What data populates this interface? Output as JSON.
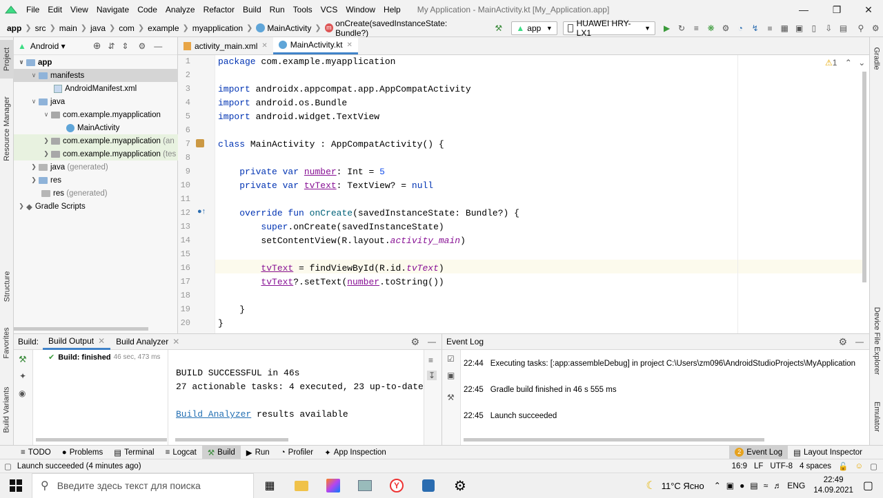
{
  "menu": {
    "items": [
      "File",
      "Edit",
      "View",
      "Navigate",
      "Code",
      "Analyze",
      "Refactor",
      "Build",
      "Run",
      "Tools",
      "VCS",
      "Window",
      "Help"
    ],
    "window_title": "My Application - MainActivity.kt [My_Application.app]"
  },
  "breadcrumb": [
    "app",
    "src",
    "main",
    "java",
    "com",
    "example",
    "myapplication",
    "MainActivity",
    "onCreate(savedInstanceState: Bundle?)"
  ],
  "toolbar": {
    "run_config": "app",
    "device": "HUAWEI HRY-LX1"
  },
  "side_tabs": {
    "left": [
      "Project",
      "Resource Manager",
      "Structure",
      "Favorites",
      "Build Variants"
    ],
    "right": [
      "Gradle",
      "Device File Explorer",
      "Emulator"
    ]
  },
  "project": {
    "view_mode": "Android",
    "tree": [
      {
        "label": "app",
        "extra": ""
      },
      {
        "label": "manifests",
        "extra": ""
      },
      {
        "label": "AndroidManifest.xml",
        "extra": ""
      },
      {
        "label": "java",
        "extra": ""
      },
      {
        "label": "com.example.myapplication",
        "extra": ""
      },
      {
        "label": "MainActivity",
        "extra": ""
      },
      {
        "label": "com.example.myapplication",
        "extra": "(an"
      },
      {
        "label": "com.example.myapplication",
        "extra": "(tes"
      },
      {
        "label": "java",
        "extra": "(generated)"
      },
      {
        "label": "res",
        "extra": ""
      },
      {
        "label": "res",
        "extra": "(generated)"
      },
      {
        "label": "Gradle Scripts",
        "extra": ""
      }
    ]
  },
  "editor": {
    "tabs": [
      "activity_main.xml",
      "MainActivity.kt"
    ],
    "warning_count": "1",
    "line_numbers": [
      "1",
      "2",
      "3",
      "4",
      "5",
      "6",
      "7",
      "8",
      "9",
      "10",
      "11",
      "12",
      "13",
      "14",
      "15",
      "16",
      "17",
      "18",
      "19",
      "20"
    ]
  },
  "build": {
    "label": "Build:",
    "tabs": [
      "Build Output",
      "Build Analyzer"
    ],
    "tree_status": "Build: finished",
    "tree_time": "46 sec, 473 ms",
    "output_line1": "BUILD SUCCESSFUL in 46s",
    "output_line2": "27 actionable tasks: 4 executed, 23 up-to-date",
    "analyzer_link": "Build Analyzer",
    "analyzer_rest": " results available"
  },
  "event_log": {
    "title": "Event Log",
    "entries": [
      {
        "time": "22:44",
        "text": "Executing tasks: [:app:assembleDebug] in project C:\\Users\\zm096\\AndroidStudioProjects\\MyApplication"
      },
      {
        "time": "22:45",
        "text": "Gradle build finished in 46 s 555 ms"
      },
      {
        "time": "22:45",
        "text": "Launch succeeded"
      }
    ]
  },
  "tool_tabs": [
    "TODO",
    "Problems",
    "Terminal",
    "Logcat",
    "Build",
    "Run",
    "Profiler",
    "App Inspection"
  ],
  "tool_tabs_right": {
    "event_log": "Event Log",
    "event_count": "2",
    "layout_inspector": "Layout Inspector"
  },
  "status": {
    "message": "Launch succeeded (4 minutes ago)",
    "position": "16:9",
    "line_sep": "LF",
    "encoding": "UTF-8",
    "indent": "4 spaces"
  },
  "taskbar": {
    "search_placeholder": "Введите здесь текст для поиска",
    "weather": "11°C  Ясно",
    "lang": "ENG",
    "time": "22:49",
    "date": "14.09.2021"
  },
  "colors": {
    "accent": "#4083c9",
    "keyword": "#0033b3",
    "function": "#00627a",
    "number": "#1750eb",
    "property": "#871094"
  }
}
